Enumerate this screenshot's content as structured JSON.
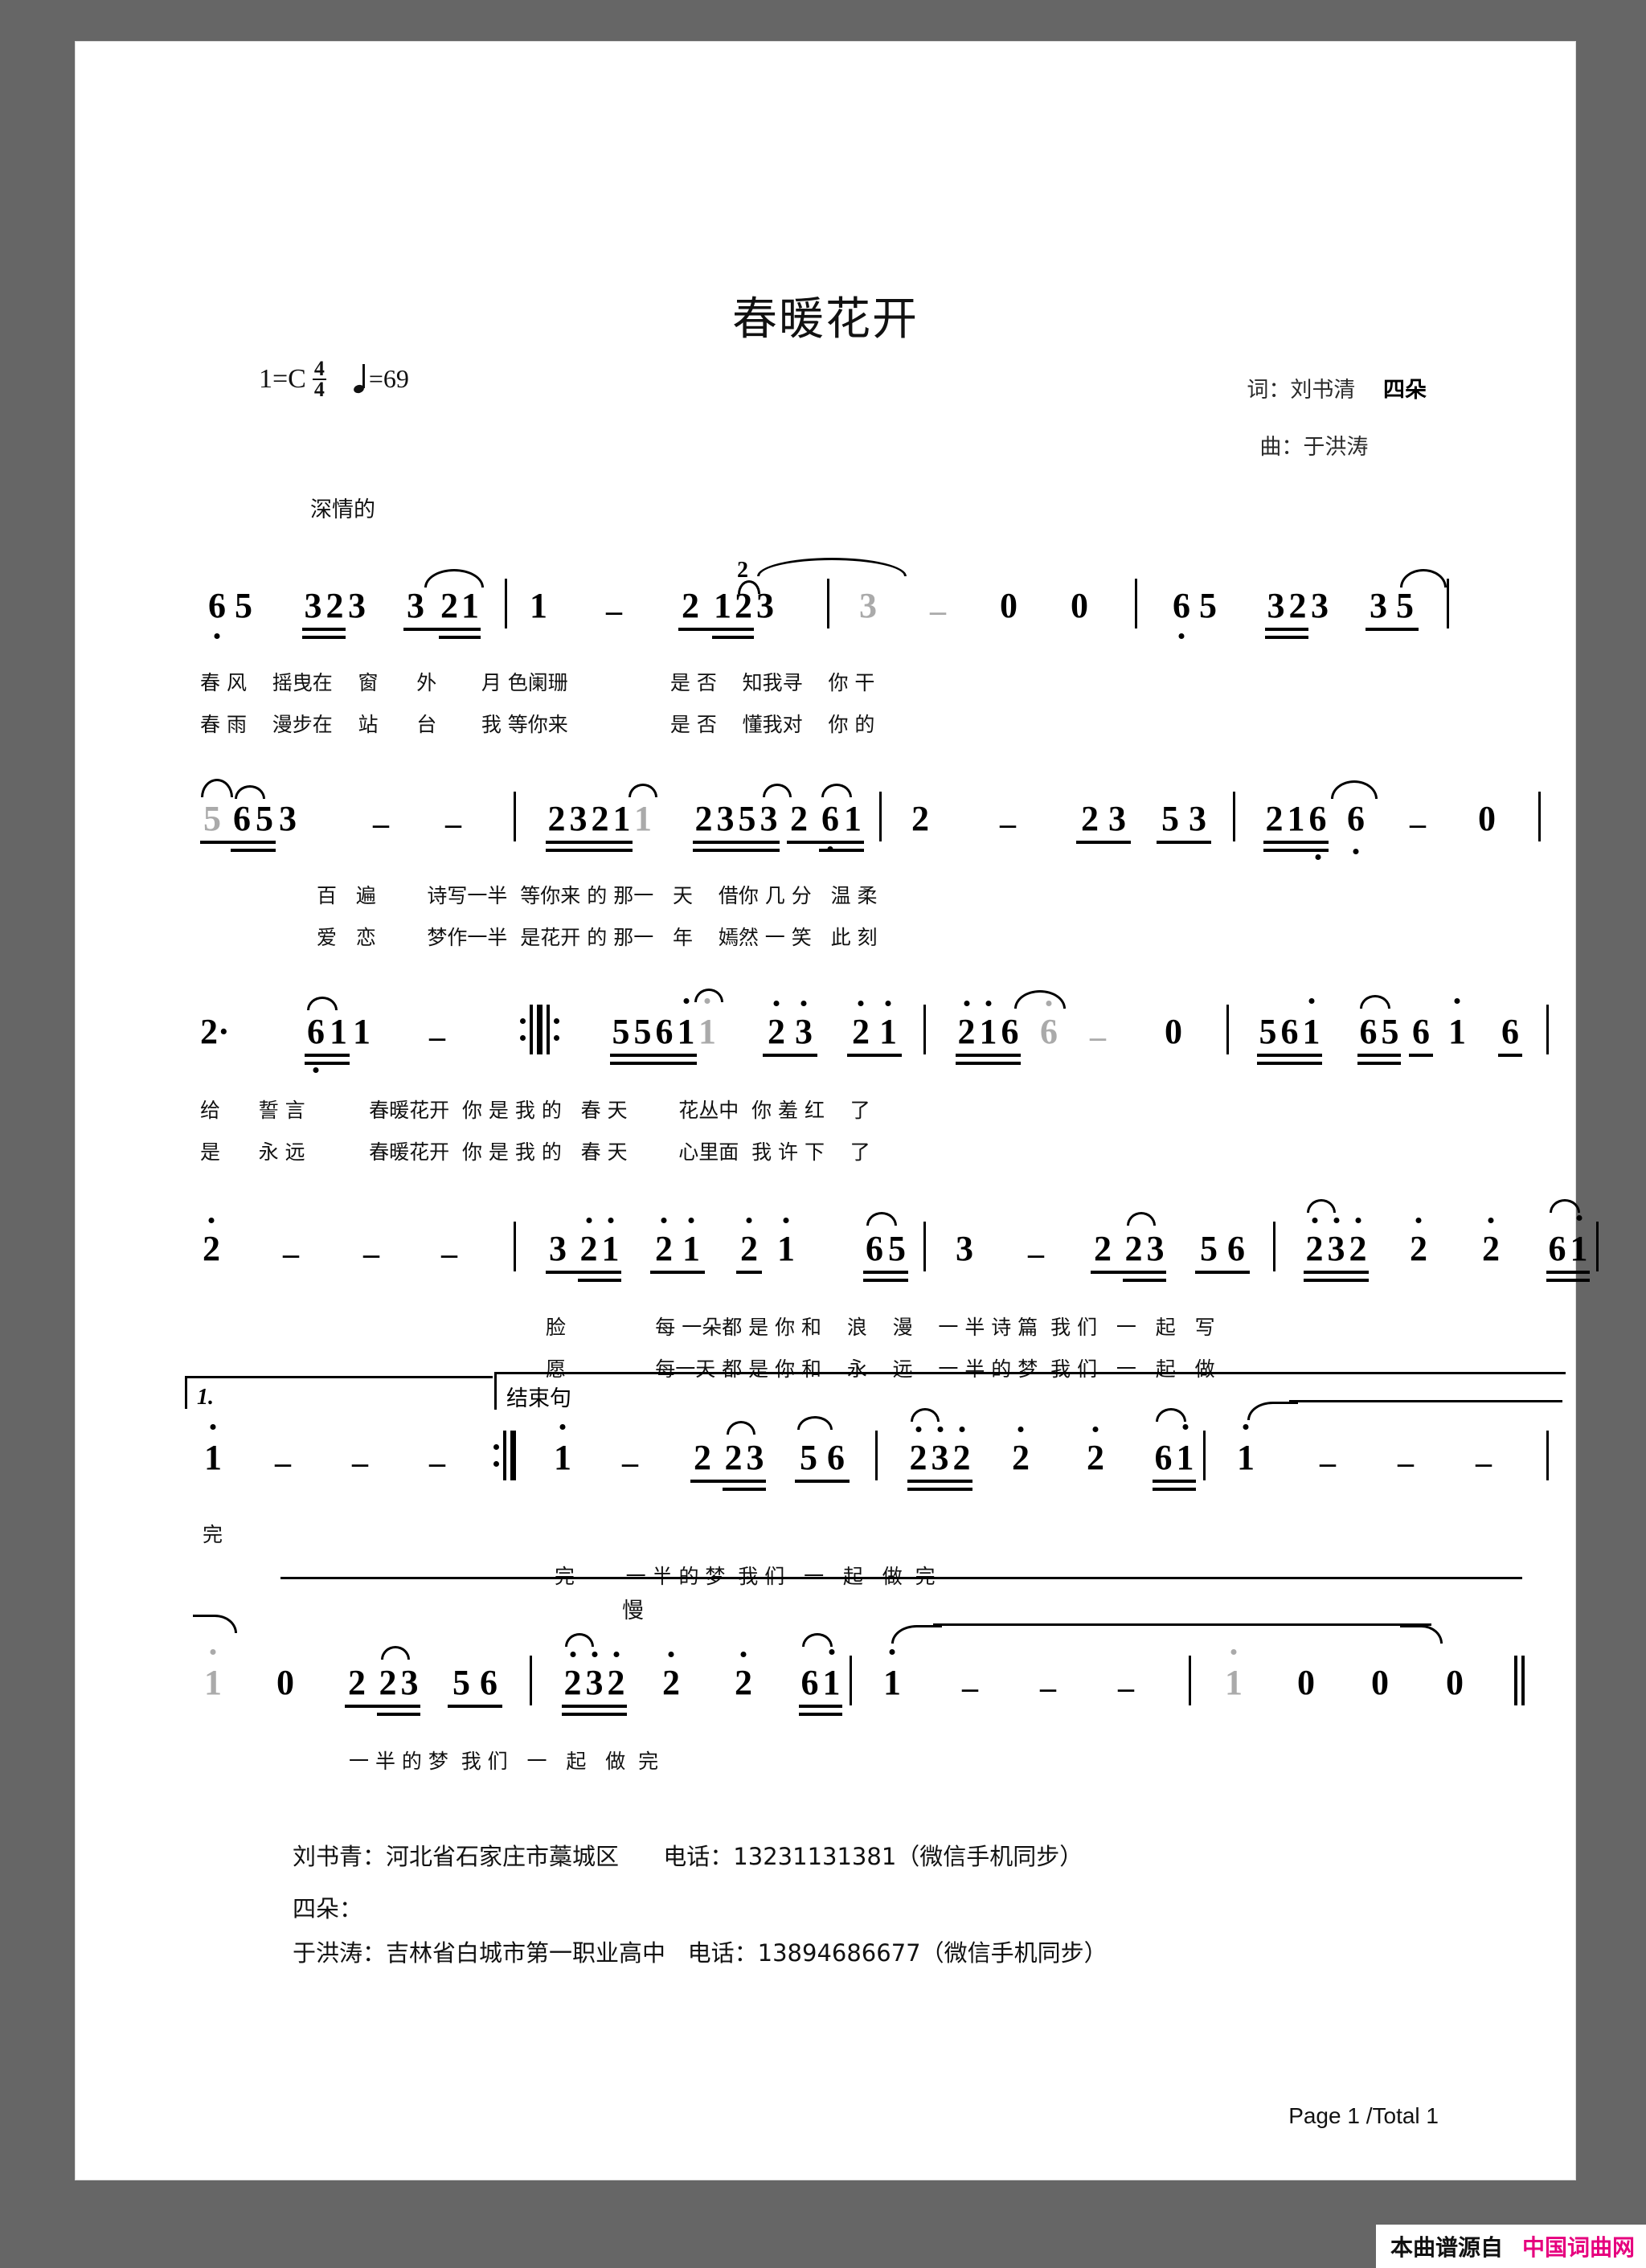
{
  "document": {
    "title": "春暖花开",
    "key_signature": "1=C",
    "time_signature": {
      "numerator": "4",
      "denominator": "4"
    },
    "tempo": "=69",
    "tempo_note_icon": "quarter-note-icon",
    "expression_marking": "深情的",
    "lyricist_label": "词：刘书清",
    "lyricist_extra": "四朵",
    "composer_label": "曲：于洪涛",
    "slow_marking": "慢",
    "volta_1_label": "1.",
    "coda_label": "结束句",
    "page_indicator": "Page 1 /Total 1"
  },
  "score": {
    "systems": [
      {
        "id": "system-1",
        "notes": "6̣ 5  3̲2̲3  3̲ 2̲1̲ | 1  -  2̲ 1̲2̲3 | 3  -  0  0 | 6̣ 5  3̲2̲3  3̲ 5̲ |",
        "lyric_line_1": "春 风    摇曳在    窗      外       月 色阑珊                是 否    知我寻    你 干",
        "lyric_line_2": "春 雨    漫步在    站      台       我 等你来                是 否    懂我对    你 的"
      },
      {
        "id": "system-2",
        "notes": "5̲ 6̲5̲ 3  -  - | 2̲3̲2̲1̲ 1  2̲3̲5̲3̲ 2̲ 6̲1̲ | 2  -  2̲3̲ 5̲3̲ | 2̲1̲6̲ 6̣  -  0 |",
        "lyric_line_1": "百   遍        诗写一半  等你来 的 那一   天    借你 几 分   温 柔",
        "lyric_line_2": "爱   恋        梦作一半  是花开 的 那一   年    嫣然 一 笑   此 刻"
      },
      {
        "id": "system-3",
        "notes": "2·  6̲1̲ 1  -  ‖: 5̲5̲6̲1̲̇ 1̇  2̇ 3  2̇ 1̇ | 2̇1̇6̲ 6̇  -  0 | 5̲6̲1̇ 6̲5̲ 6̲ 1̇  6̲ |",
        "lyric_line_1": "给      誓 言          春暖花开  你 是 我 的   春 天        花丛中  你 羞 红    了",
        "lyric_line_2": "是      永 远          春暖花开  你 是 我 的   春 天        心里面  我 许 下    了"
      },
      {
        "id": "system-4",
        "notes": "2̇  -  -  - | 3̲ 2̲̇1̲̇ 2̲̇ 1̲̇ 2̲̇ 1̇ 6̲5̲ | 3  -  2̲ 2̲3̲5̲ 6̲ | 2̲̇3̲̇2̲̇ 2̇  2̇  6̲1̲̇ |",
        "lyric_line_1": "脸              每 一朵都 是 你 和    浪    漫    一 半 诗 篇  我 们   一   起   写",
        "lyric_line_2": "愿              每一天 都 是 你 和    永    远    一 半 的 梦  我 们   一   起   做"
      },
      {
        "id": "system-5",
        "notes": "1̇  -  -  -  :‖ 1̇  -  2̲ 2̲3̲5̲ 6̲ | 2̲̇3̲̇2̲̇ 2̇ 2̇ 6̲1̲̇ | 1̇  -  -  - |",
        "lyric_line_1": "完",
        "lyric_line_2": "完        一 半 的 梦  我 们   一   起   做  完"
      },
      {
        "id": "system-6",
        "notes": "1̇  0  2̲ 2̲3̲5̲ 6̲ | 2̲̇3̲̇2̲̇ 2̇ 2̇ 6̲1̲̇ | 1̇  -  -  - | 1̇  0  0  0 ‖",
        "lyric_line_1": "一 半 的 梦  我 们   一   起   做  完"
      }
    ]
  },
  "footer": {
    "contact_lines": [
      "刘书青：河北省石家庄市藁城区      电话：13231131381（微信手机同步）",
      "四朵：",
      "于洪涛：吉林省白城市第一职业高中   电话：13894686677（微信手机同步）"
    ]
  },
  "watermark": {
    "source_label": "本曲谱源自",
    "site_label": "中国词曲网",
    "site_color": "#e6007e"
  }
}
